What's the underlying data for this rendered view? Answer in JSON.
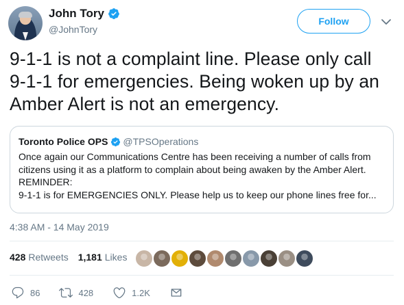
{
  "author": {
    "name": "John Tory",
    "handle": "@JohnTory"
  },
  "header": {
    "follow_label": "Follow"
  },
  "tweet": {
    "text_lines": [
      "9-1-1 is not a complaint line. Please only call",
      "9-1-1 for emergencies. Being woken up by an",
      "Amber Alert is not an emergency."
    ],
    "timestamp": "4:38 AM - 14 May 2019"
  },
  "quote": {
    "name": "Toronto Police OPS",
    "handle": "@TPSOperations",
    "body_lines": [
      "Once again our Communications Centre has been receiving a number of calls from",
      "citizens using it as a platform to complain about being awaken by the Amber Alert.",
      "REMINDER:",
      "9-1-1 is for EMERGENCIES ONLY. Please help us to keep our phone lines free for..."
    ]
  },
  "stats": {
    "retweets_count": "428",
    "retweets_label": "Retweets",
    "likes_count": "1,181",
    "likes_label": "Likes"
  },
  "likers": [
    "#c8b6a6",
    "#7b6a5c",
    "#e2b007",
    "#5d4b3c",
    "#b08a6e",
    "#6f6f6f",
    "#8899aa",
    "#4a4036",
    "#9a8f84",
    "#3e4b5c"
  ],
  "actions": {
    "replies": "86",
    "retweets": "428",
    "likes": "1.2K"
  },
  "colors": {
    "accent": "#1da1f2",
    "secondary_text": "#657786",
    "border": "#ccd6dd"
  }
}
